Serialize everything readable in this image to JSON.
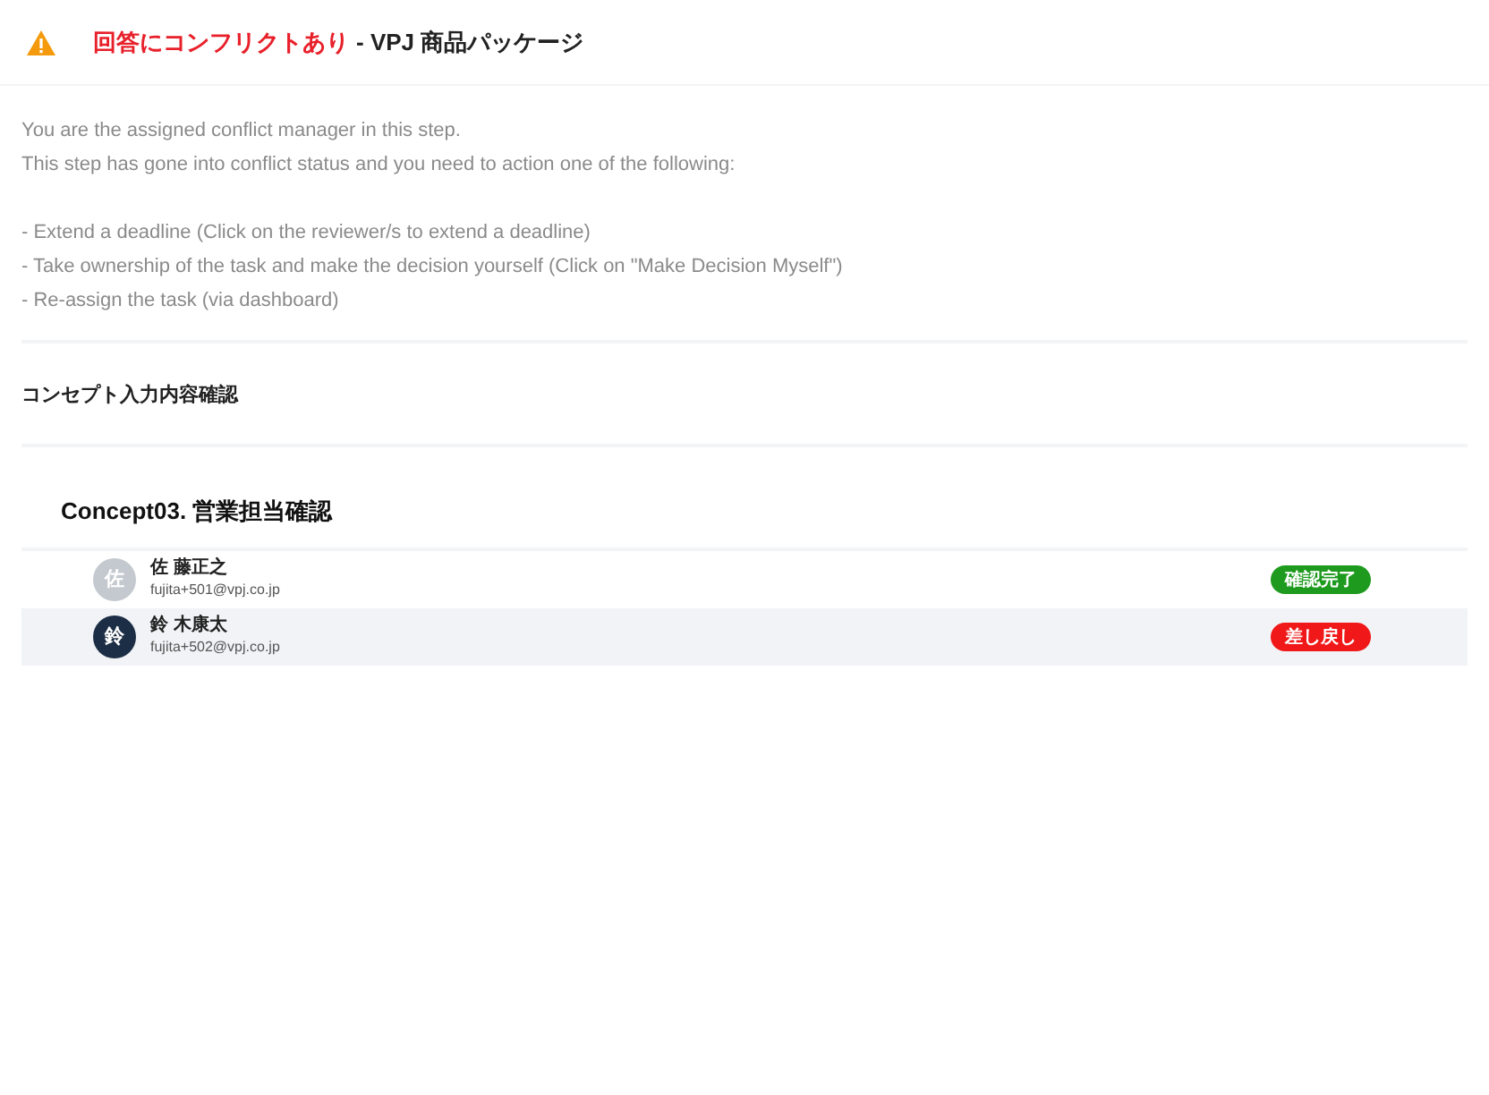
{
  "header": {
    "alert": "回答にコンフリクトあり",
    "title": "- VPJ 商品パッケージ"
  },
  "message": [
    "You are the assigned conflict manager in this step.",
    "This step has gone into conflict status and you need to action one of the following:"
  ],
  "actions": [
    "- Extend a deadline (Click on the reviewer/s to extend a deadline)",
    "- Take ownership of the task and make the decision yourself (Click on \"Make Decision Myself\")",
    "- Re-assign the task (via dashboard)"
  ],
  "section": {
    "title": "コンセプト入力内容確認"
  },
  "step": {
    "title": "Concept03. 営業担当確認",
    "reviewers": [
      {
        "avatar": "佐",
        "color": "#c4c9cf",
        "name": "佐 藤正之",
        "email": "fujita+501@vpj.co.jp",
        "status": {
          "label": "確認完了",
          "color": "#1e9a1e"
        },
        "selected": false
      },
      {
        "avatar": "鈴",
        "color": "#1c2e45",
        "name": "鈴 木康太",
        "email": "fujita+502@vpj.co.jp",
        "status": {
          "label": "差し戻し",
          "color": "#f01818"
        },
        "selected": true
      }
    ]
  }
}
